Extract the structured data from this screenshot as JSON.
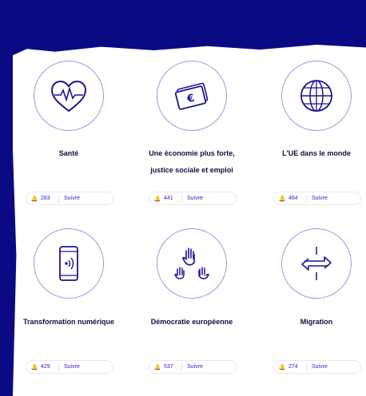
{
  "cards": [
    {
      "title": "Santé",
      "title2": "",
      "count": "283",
      "follow": "Suivre",
      "icon": "heartbeat-icon"
    },
    {
      "title": "Une économie plus forte,",
      "title2": "justice sociale et emploi",
      "count": "441",
      "follow": "Suivre",
      "icon": "euro-banknotes-icon"
    },
    {
      "title": "L'UE dans le monde",
      "title2": "",
      "count": "464",
      "follow": "Suivre",
      "icon": "globe-icon"
    },
    {
      "title": "Transformation numérique",
      "title2": "",
      "count": "429",
      "follow": "Suivre",
      "icon": "smartphone-icon"
    },
    {
      "title": "Démocratie européenne",
      "title2": "",
      "count": "537",
      "follow": "Suivre",
      "icon": "raised-hands-icon"
    },
    {
      "title": "Migration",
      "title2": "",
      "count": "274",
      "follow": "Suivre",
      "icon": "migration-arrows-icon"
    }
  ],
  "colors": {
    "background": "#0b0a85",
    "accent": "#2a27b8",
    "circle_border": "#9b98e6"
  }
}
